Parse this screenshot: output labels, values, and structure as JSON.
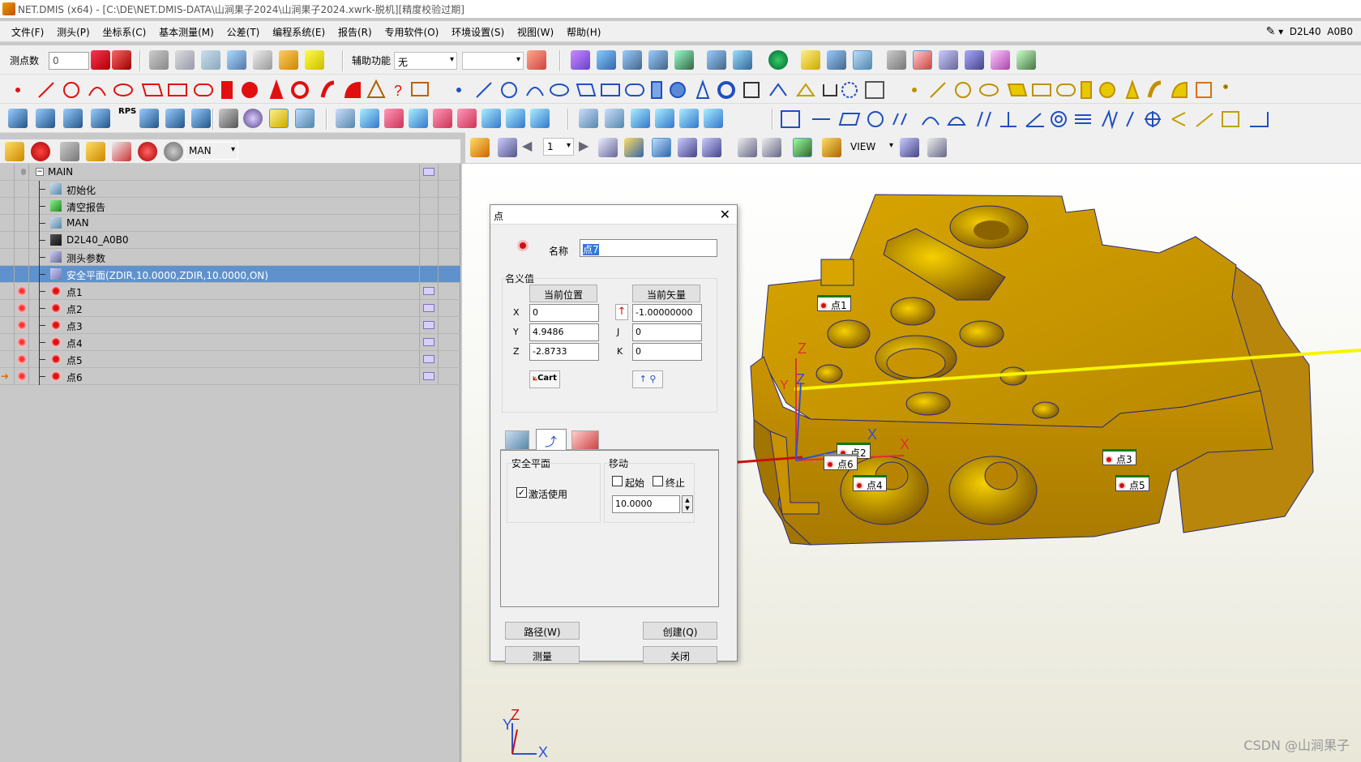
{
  "window": {
    "title": "NET.DMIS (x64) - [C:\\DE\\NET.DMIS-DATA\\山涧果子2024\\山涧果子2024.xwrk-脱机][精度校验过期]"
  },
  "menubar": {
    "items": [
      "文件(F)",
      "测头(P)",
      "坐标系(C)",
      "基本测量(M)",
      "公差(T)",
      "编程系统(E)",
      "报告(R)",
      "专用软件(O)",
      "环境设置(S)",
      "视图(W)",
      "帮助(H)"
    ],
    "probe_label": "D2L40",
    "angle_label": "A0B0"
  },
  "toolbar1": {
    "points_label": "测点数",
    "points_value": "0",
    "aux_label": "辅助功能",
    "aux_value": "无"
  },
  "toolbar2": {
    "rps_label": "RPS"
  },
  "left_toolbar": {
    "mode_value": "MAN"
  },
  "tree": {
    "root": "MAIN",
    "items": [
      {
        "label": "初始化",
        "icon": "init-icon",
        "type": "child"
      },
      {
        "label": "清空报告",
        "icon": "clear-report-icon",
        "type": "child"
      },
      {
        "label": "MAN",
        "icon": "mode-icon",
        "type": "child"
      },
      {
        "label": "D2L40_A0B0",
        "icon": "probe-icon",
        "type": "child"
      },
      {
        "label": "测头参数",
        "icon": "probe-params-icon",
        "type": "child"
      },
      {
        "label": "安全平面(ZDIR,10.0000,ZDIR,10.0000,ON)",
        "icon": "safe-plane-icon",
        "type": "selected"
      },
      {
        "label": "点1",
        "icon": "point-icon",
        "type": "feature"
      },
      {
        "label": "点2",
        "icon": "point-icon",
        "type": "feature"
      },
      {
        "label": "点3",
        "icon": "point-icon",
        "type": "feature"
      },
      {
        "label": "点4",
        "icon": "point-icon",
        "type": "feature"
      },
      {
        "label": "点5",
        "icon": "point-icon",
        "type": "feature"
      },
      {
        "label": "点6",
        "icon": "point-icon",
        "type": "current"
      }
    ]
  },
  "viewtoolbar": {
    "page_value": "1",
    "view_value": "VIEW"
  },
  "dialog": {
    "title": "点",
    "name_label": "名称",
    "name_value": "点7",
    "nominal_label": "名义值",
    "current_pos_button": "当前位置",
    "current_vec_button": "当前矢量",
    "x_label": "X",
    "y_label": "Y",
    "z_label": "Z",
    "i_label": "I",
    "j_label": "J",
    "k_label": "K",
    "x_value": "0",
    "y_value": "4.9486",
    "z_value": "-2.8733",
    "i_value": "-1.00000000",
    "j_value": "0",
    "k_value": "0",
    "cart_button": "Cart",
    "safe_plane_group": "安全平面",
    "activate_label": "激活使用",
    "move_group": "移动",
    "start_label": "起始",
    "end_label": "终止",
    "distance_value": "10.0000",
    "path_button": "路径(W)",
    "create_button": "创建(Q)",
    "measure_button": "测量",
    "close_button": "关闭"
  },
  "viewport": {
    "markers": [
      "点1",
      "点2",
      "点3",
      "点4",
      "点5",
      "点6"
    ],
    "axis_x": "X",
    "axis_y": "Y",
    "axis_z": "Z"
  },
  "watermark": "CSDN @山涧果子",
  "colors": {
    "part": "#c99400",
    "selection": "#5f92cc",
    "probe_line": "#f5f500",
    "vector_arrow": "#cc1010"
  }
}
